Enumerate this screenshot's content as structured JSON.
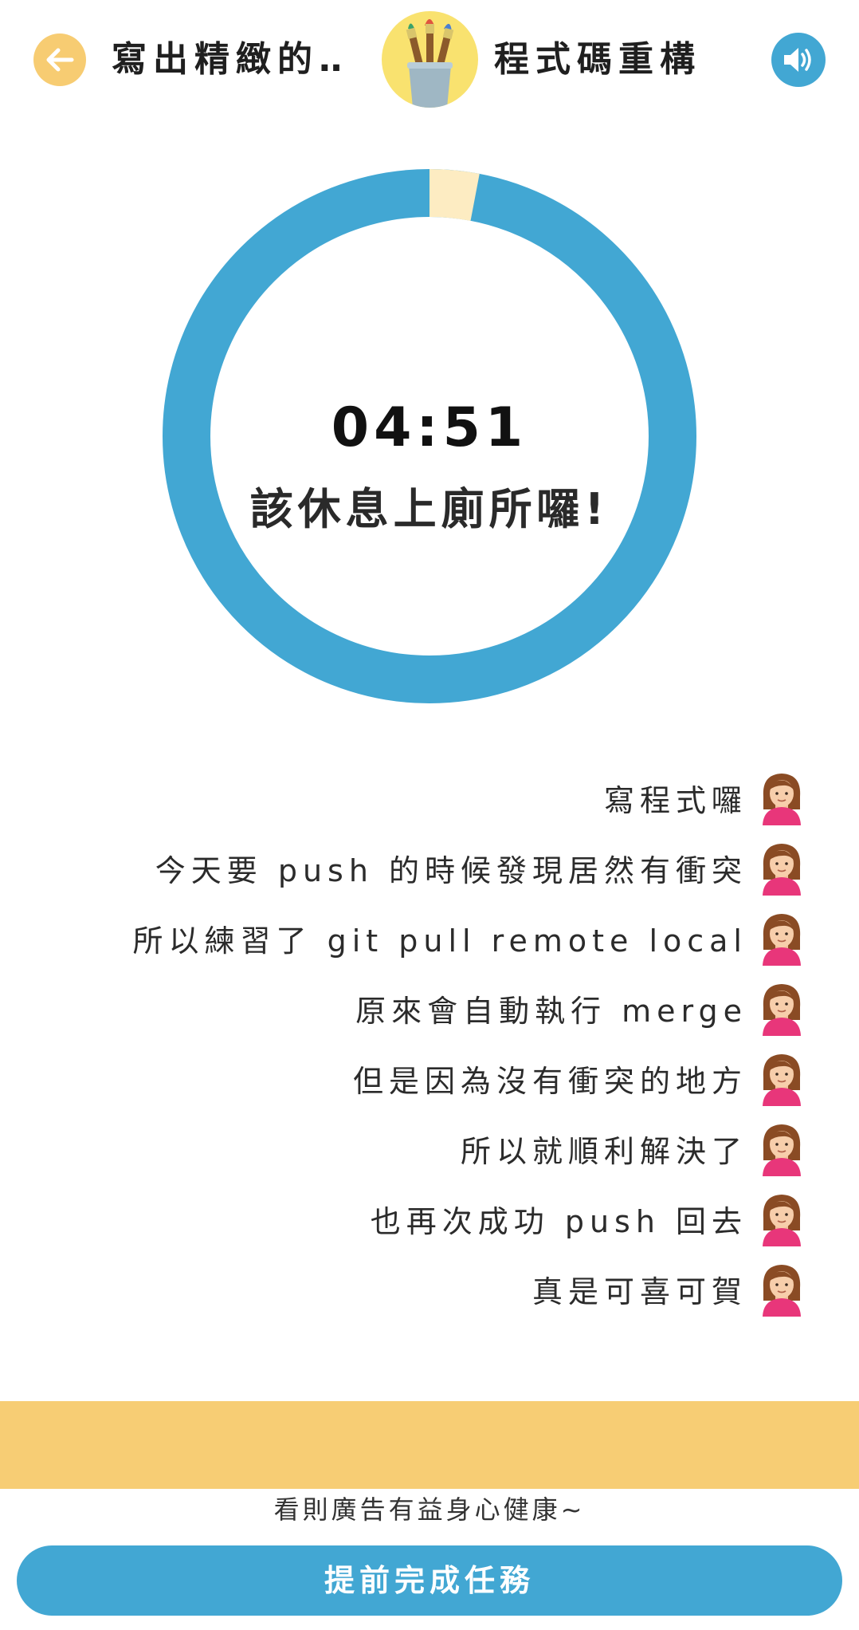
{
  "header": {
    "title_left": "寫出精緻的‥",
    "title_right": "程式碼重構",
    "back_icon": "arrow-left-icon",
    "sound_icon": "speaker-volume-icon",
    "logo_icon": "paintbrush-cup-logo"
  },
  "timer": {
    "time": "04:51",
    "message": "該休息上廁所囉!",
    "elapsed_fraction": 0.03,
    "ring_color": "#42a7d3",
    "elapsed_color": "#fdecc2"
  },
  "log": {
    "entries": [
      "寫程式囉",
      "今天要 push 的時候發現居然有衝突",
      "所以練習了 git pull remote local",
      "原來會自動執行 merge",
      "但是因為沒有衝突的地方",
      "所以就順利解決了",
      "也再次成功 push 回去",
      "真是可喜可賀"
    ],
    "avatar_icon": "girl-avatar-icon"
  },
  "ad": {
    "caption": "看則廣告有益身心健康~"
  },
  "actions": {
    "finish_label": "提前完成任務"
  },
  "colors": {
    "accent_blue": "#42a7d3",
    "accent_yellow": "#f7cd74"
  }
}
